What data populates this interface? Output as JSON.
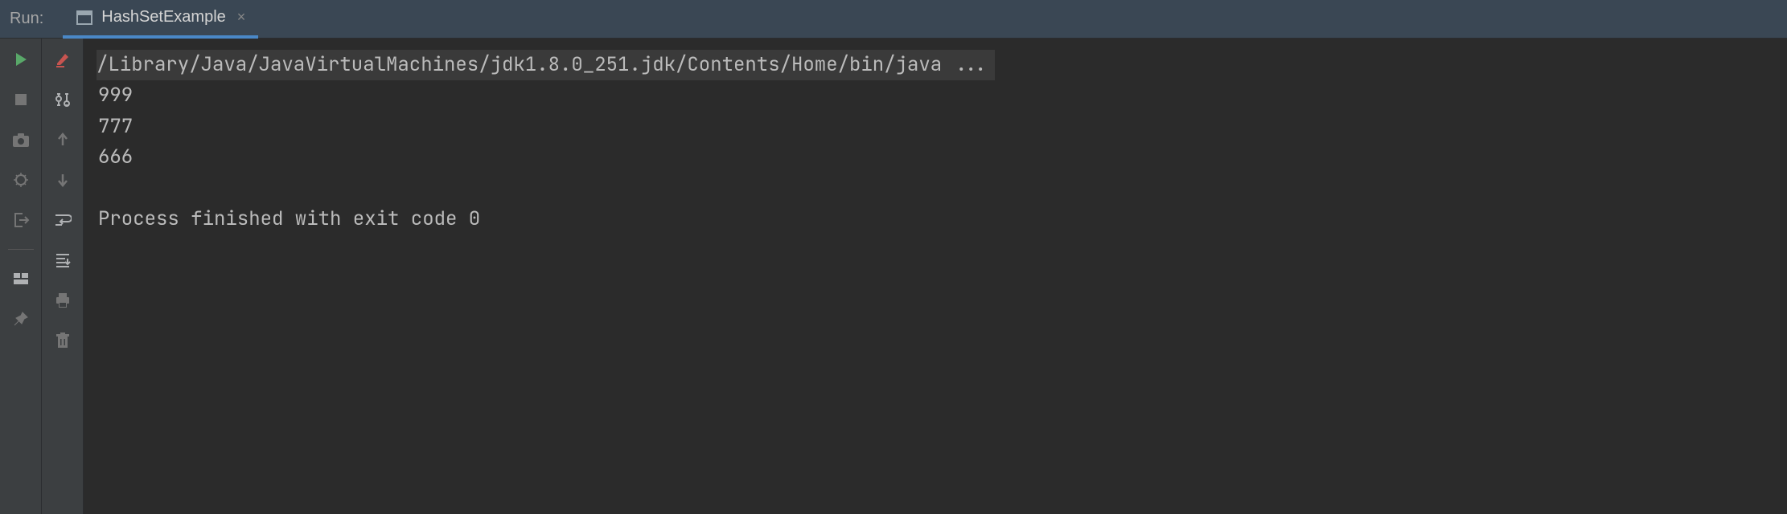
{
  "header": {
    "run_label": "Run:",
    "tab": {
      "icon": "app-window-icon",
      "label": "HashSetExample",
      "close": "×"
    }
  },
  "console": {
    "lines": [
      "/Library/Java/JavaVirtualMachines/jdk1.8.0_251.jdk/Contents/Home/bin/java ...",
      "999",
      "777",
      "666",
      "",
      "Process finished with exit code 0"
    ]
  },
  "toolbars": {
    "left": [
      "run-icon",
      "stop-icon",
      "camera-icon",
      "debug-icon",
      "exit-icon",
      "layout-icon",
      "pin-icon"
    ],
    "left2": [
      "highlight-icon",
      "filter-icon",
      "up-arrow-icon",
      "down-arrow-icon",
      "soft-wrap-icon",
      "scroll-to-end-icon",
      "print-icon",
      "trash-icon"
    ]
  }
}
